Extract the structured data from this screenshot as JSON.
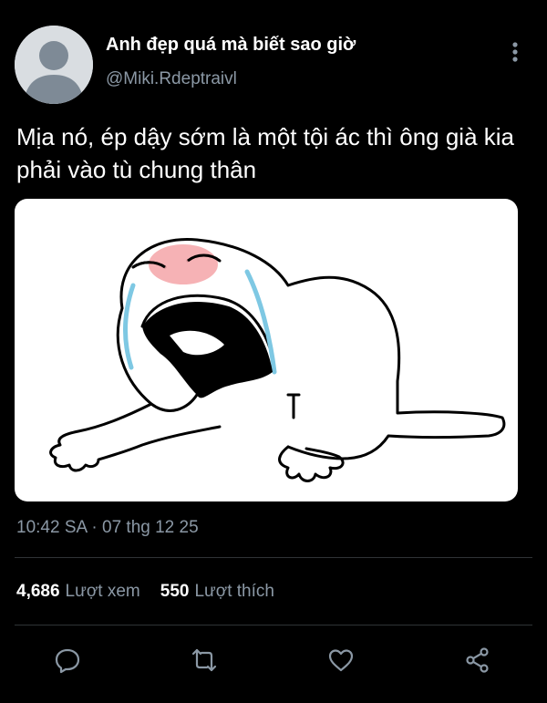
{
  "author": {
    "display_name": "Anh đẹp quá mà biết sao giờ",
    "handle": "@Miki.Rdeptraivl",
    "avatar_icon": "default-avatar-icon"
  },
  "tweet": {
    "text": "Mịa nó, ép dậy sớm là một tội ác thì ông già kia phải vào tù chung thân",
    "media_description_icon": "crying-meme-drawing",
    "time": "10:42 SA",
    "separator": " · ",
    "date": "07 thg 12 25"
  },
  "stats": {
    "views_count": "4,686",
    "views_label": "Lượt xem",
    "likes_count": "550",
    "likes_label": "Lượt thích"
  },
  "actions": [
    {
      "name": "reply-icon"
    },
    {
      "name": "retweet-icon"
    },
    {
      "name": "like-icon"
    },
    {
      "name": "share-icon"
    }
  ],
  "colors": {
    "background": "#000000",
    "text": "#ffffff",
    "muted": "#8b98a5",
    "divider": "#2f3336"
  }
}
